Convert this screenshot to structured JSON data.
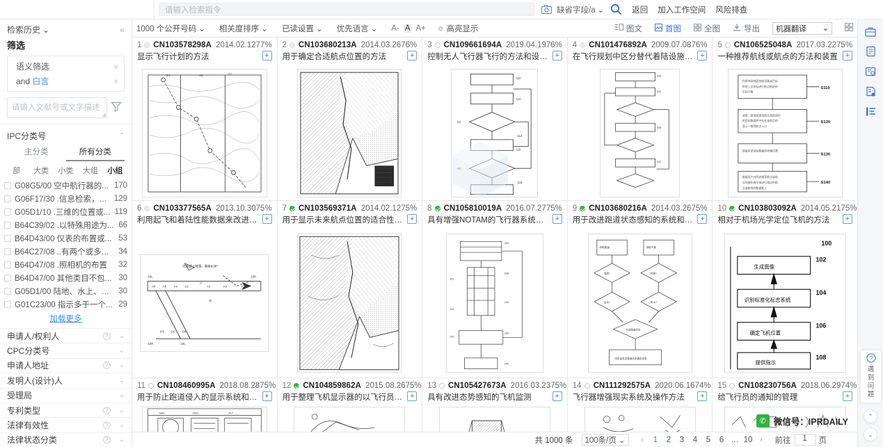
{
  "search": {
    "placeholder": "请输入检索指令",
    "field_selector": "缺省字段/a",
    "camera_icon": "camera-icon",
    "magnifier_icon": "search-icon",
    "links": [
      "返回",
      "加入工作空间",
      "风险排查"
    ]
  },
  "sidebar": {
    "history_label": "检索历史",
    "collapse_icon": "«",
    "title": "筛选",
    "conditions": [
      {
        "label": "语义筛选",
        "prefix": "",
        "close": "×"
      },
      {
        "label": "白言",
        "prefix": "and",
        "close": "×"
      }
    ],
    "textarea_placeholder": "请输入文献号或文字描述",
    "funnel_icon": "filter-icon",
    "ipc": {
      "title": "IPC分类号",
      "tabs": [
        "主分类",
        "所有分类"
      ],
      "active_tab": "所有分类",
      "levels": [
        "部",
        "大类",
        "小类",
        "大组",
        "小组"
      ],
      "active_level": "小组",
      "items": [
        {
          "code": "G08G5/00",
          "desc": "空中航行器的...",
          "count": "170"
        },
        {
          "code": "G06F17/30",
          "desc": ".信息检索，其...",
          "count": "129"
        },
        {
          "code": "G05D1/10",
          "desc": ".三维的位置或...",
          "count": "119"
        },
        {
          "code": "B64C39/02",
          "desc": ".以特殊用途为...",
          "count": "66"
        },
        {
          "code": "B64D43/00",
          "desc": "仪表的布置或...",
          "count": "53"
        },
        {
          "code": "B64C27/08",
          "desc": "..有两个或多个...",
          "count": "34"
        },
        {
          "code": "B64D47/08",
          "desc": ".照相机的布置",
          "count": "32"
        },
        {
          "code": "B64D47/00",
          "desc": "其他类目不包...",
          "count": "30"
        },
        {
          "code": "G05D1/00",
          "desc": "陆地、水上、空...",
          "count": "30"
        },
        {
          "code": "G01C23/00",
          "desc": "指示多于一个...",
          "count": "29"
        }
      ],
      "load_more": "加载更多"
    },
    "accordions": [
      {
        "label": "申请人/权利人",
        "help": true
      },
      {
        "label": "CPC分类号",
        "help": false
      },
      {
        "label": "申请人地址",
        "help": true
      },
      {
        "label": "发明人(设计)人",
        "help": false
      },
      {
        "label": "受理局",
        "help": false
      },
      {
        "label": "专利类型",
        "help": true
      },
      {
        "label": "法律有效性",
        "help": true
      },
      {
        "label": "法律状态分类",
        "help": true
      }
    ]
  },
  "toolbar": {
    "left_items": [
      "1000 个公开号码",
      "相关度排序",
      "已读设置",
      "优先语言"
    ],
    "font_sizes": [
      "A-",
      "A",
      "A+"
    ],
    "font_active": "A",
    "highlight_label": "高亮显示",
    "highlight_icon": "sun-icon",
    "right_items": [
      {
        "label": "图文",
        "icon": "list-text-icon",
        "active": false
      },
      {
        "label": "首图",
        "icon": "image-icon",
        "active": true
      },
      {
        "label": "全图",
        "icon": "grid-icon",
        "active": false
      },
      {
        "label": "导出",
        "icon": "download-icon",
        "active": false
      }
    ],
    "translate_select": "机器翻译",
    "grid_icon": "layout-grid-icon"
  },
  "results": [
    {
      "index": "1",
      "status": "gray",
      "number": "CN103578298A",
      "date": "2014.02.12",
      "pct": "77%",
      "title": "显示飞行计划的方法",
      "figure": "contour-map"
    },
    {
      "index": "2",
      "status": "gray",
      "number": "CN103680213A",
      "date": "2014.03.26",
      "pct": "76%",
      "title": "用于确定合适航点位置的方法",
      "figure": "terrain-map"
    },
    {
      "index": "3",
      "status": "empty",
      "number": "CN109661694A",
      "date": "2019.04.19",
      "pct": "76%",
      "title": "控制无人飞行器飞行的方法和设备、...",
      "figure": "flowchart"
    },
    {
      "index": "4",
      "status": "gray",
      "number": "CN101476892A",
      "date": "2009.07.08",
      "pct": "76%",
      "title": "在飞行规划中区分替代着陆设施的优...",
      "figure": "flowchart2"
    },
    {
      "index": "5",
      "status": "empty",
      "number": "CN106525048A",
      "date": "2017.03.22",
      "pct": "75%",
      "title": "一种推荐航线或航点的方法和装置",
      "figure": "steps-boxes"
    },
    {
      "index": "6",
      "status": "gray",
      "number": "CN103377565A",
      "date": "2013.10.30",
      "pct": "75%",
      "title": "利用起飞和着陆性能数据来改进跑道...",
      "figure": "runway-diagram"
    },
    {
      "index": "7",
      "status": "green",
      "number": "CN103569371A",
      "date": "2014.02.12",
      "pct": "75%",
      "title": "用于显示未来航点位置的适合性的方法",
      "figure": "terrain-map2"
    },
    {
      "index": "8",
      "status": "green",
      "number": "CN105810019A",
      "date": "2016.07.27",
      "pct": "75%",
      "title": "具有增强NOTAM的飞行器系统和方法",
      "figure": "technical-drawing"
    },
    {
      "index": "9",
      "status": "green",
      "number": "CN103680216A",
      "date": "2014.03.26",
      "pct": "75%",
      "title": "用于改进跑道状态感知的系统和方法",
      "figure": "decision-flow"
    },
    {
      "index": "10",
      "status": "green",
      "number": "CN103803092A",
      "date": "2014.05.21",
      "pct": "75%",
      "title": "相对于机场光学定位飞机的方法",
      "figure": "numbered-steps"
    },
    {
      "index": "11",
      "status": "empty",
      "number": "CN108460995A",
      "date": "2018.08.28",
      "pct": "75%",
      "title": "用于防止跑道侵入的显示系统和方法",
      "figure": "cockpit-display"
    },
    {
      "index": "12",
      "status": "green",
      "number": "CN104859862A",
      "date": "2015.08.26",
      "pct": "75%",
      "title": "用于整理飞机显示器的以飞行员为中...",
      "figure": "sketch"
    },
    {
      "index": "13",
      "status": "empty",
      "number": "CN105427673A",
      "date": "2016.03.23",
      "pct": "75%",
      "title": "具有改进态势感知的飞机监测",
      "figure": "section-view"
    },
    {
      "index": "14",
      "status": "empty",
      "number": "CN111292575A",
      "date": "2020.06.16",
      "pct": "74%",
      "title": "飞行器增强现实系统及操作方法",
      "figure": "ar-sketch"
    },
    {
      "index": "15",
      "status": "empty",
      "number": "CN108230756A",
      "date": "2018.06.29",
      "pct": "74%",
      "title": "给飞行员的通知的管理",
      "figure": "notification"
    }
  ],
  "pager": {
    "total_label": "共 1000 条",
    "page_size": "100条/页",
    "prev": "‹",
    "next": "›",
    "pages": [
      "1",
      "2",
      "3",
      "4",
      "5",
      "6",
      "…",
      "10"
    ],
    "current": "1",
    "goto_label": "前往",
    "goto_value": "1",
    "page_unit": "页"
  },
  "rail": {
    "icons": [
      "briefcase-icon",
      "document-icon",
      "report-icon",
      "note-add-icon",
      "outline-icon"
    ],
    "help_icon": "question-circle-icon",
    "help_text": [
      "遇",
      "到",
      "问",
      "题"
    ],
    "scroll_up": "scroll-up-icon",
    "scroll_down": "scroll-down-icon"
  },
  "watermark": {
    "text": "微信号：IPRDAILY",
    "logo": "wechat-icon"
  }
}
